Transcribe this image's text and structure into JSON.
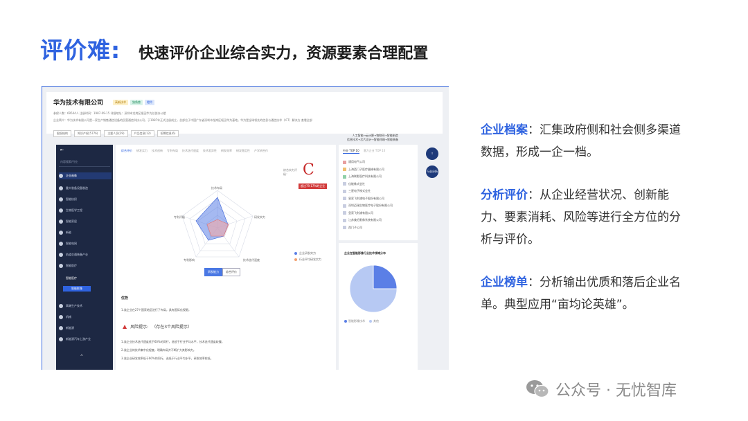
{
  "heading": {
    "key": "评价难:",
    "subtitle": "快速评价企业综合实力，资源要素合理配置"
  },
  "screenshot": {
    "company_name": "华为技术有限公司",
    "tags": [
      "高新技术",
      "独角兽",
      "瞪羚"
    ],
    "meta": "参保人数：69544人      注册时间：1987-09-15      详细地址：深圳市龙岗区坂田华为总部办公楼",
    "desc": "企业简介：华为技术有限公司是一家生产销售通信设备的民营通信科技公司，于1987年正式注册成立，总部位于中国广东省深圳市龙岗区坂田华为基地。华为是全球领先的信息与通信技术（ICT）解决方   查看全部",
    "buttons": [
      "股权结构",
      "知识产权(5776)",
      "主要人员(29)",
      "产品信息(12)",
      "招聘信息(6)"
    ],
    "right_note": "人工智能→云计算→物联网→智能制造\n信息技术→芯片设计→智能终端→智能装备",
    "sidebar": {
      "search_placeholder": "内容搜索/行业",
      "items": [
        "企业画像",
        "重大装备设备制造",
        "智能纺织",
        "生物医学工程",
        "智能家居",
        "新能",
        "智能电网",
        "轨道交通装备产业",
        "智能医疗"
      ],
      "subitems": [
        "智能医疗",
        "智能影像"
      ],
      "items2": [
        "高端生产技术",
        "机械",
        "新能源",
        "新能源汽车上游产业"
      ]
    },
    "main_tabs": [
      "综合评价",
      "研发实力",
      "技术创新",
      "专利布局",
      "技术迭代速度",
      "技术差异性",
      "研发效率",
      "研发稳定性",
      "产学研合作"
    ],
    "grade_label": "综合实力评级：",
    "grade": "C",
    "grade_rank": "超过79.17%的企业",
    "radar_labels": [
      "技术布局",
      "研发实力",
      "技术迭代速度",
      "专利影响",
      "专利评级"
    ],
    "radar_legend": [
      "企业研发实力",
      "行业平均研发实力"
    ],
    "switch": [
      "研发能力",
      "综合评价"
    ],
    "advantage_title": "优势",
    "advantage_text": "1.该企业在27个国家地区进行了布局，具有国际化视野。",
    "risk_title": "风险提示:",
    "risk_count": "（存在3个风险提示）",
    "risk_lines": [
      "1.该企业技术迭代速度低于60%的同行，选低于行业平均水平，技术迭代速度较慢。",
      "2.该企业的技术集中化程度，明确布局并不断扩大其影响力。",
      "3.该企业研发效率低于60%的同行，选低于行业平均水平，研发效率较低。"
    ],
    "rank_tabs": [
      "行业 TOP 10",
      "潜力企业 TOP 10"
    ],
    "rank_list": [
      "通用电气公司",
      "上海西门子医疗器械有限公司",
      "上海联影医疗科技有限公司",
      "佳能株式会社",
      "三星电子株式会社",
      "皇家飞利浦电子股份有限公司",
      "深圳迈瑞生物医疗电子股份有限公司",
      "皇家飞利浦有限公司",
      "江苏美伦影像系统有限公司",
      "西门子公司"
    ],
    "pie_title": "企业在智能影像行业技术领域分布",
    "pie_legend": [
      "智能影像技术",
      "其他"
    ],
    "fab_labels": [
      "",
      "行业分析"
    ]
  },
  "chart_data": {
    "type": "pie",
    "labels": [
      "智能影像技术",
      "其他"
    ],
    "values": [
      25,
      75
    ],
    "colors": [
      "#5b7fe6",
      "#b7c9f3"
    ]
  },
  "bullets": [
    {
      "key": "企业档案",
      "text": "：汇集政府侧和社会侧多渠道数据，形成一企一档。"
    },
    {
      "key": "分析评价",
      "text": "：从企业经营状况、创新能力、要素消耗、风险等进行全方位的分析与评价。"
    },
    {
      "key": "企业榜单",
      "text": "：分析输出优质和落后企业名单。典型应用“亩均论英雄”。"
    }
  ],
  "watermark": "公众号 · 无忧智库",
  "colors": {
    "accent": "#2f63e0",
    "sidebar": "#1d2843",
    "grade": "#c62828"
  }
}
